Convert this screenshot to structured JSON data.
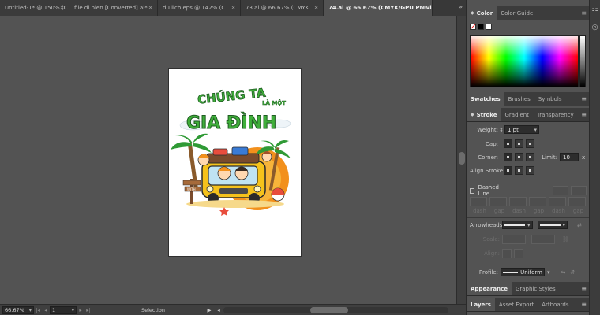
{
  "doc_tabs": [
    {
      "label": "Untitled-1* @ 150% (C...",
      "active": false
    },
    {
      "label": "file di bien [Converted].ai*",
      "active": false
    },
    {
      "label": "du lich.eps @ 142% (C...",
      "active": false
    },
    {
      "label": "73.ai @ 66.67% (CMYK...",
      "active": false
    },
    {
      "label": "74.ai @ 66.67% (CMYK/GPU Preview)",
      "active": true
    }
  ],
  "artwork": {
    "line1": "CHÚNG TA",
    "line2": "LÀ MỘT",
    "line3": "GIA ĐÌNH",
    "sign": "WITH"
  },
  "status_bar": {
    "zoom": "66.67%",
    "page": "1",
    "tool": "Selection"
  },
  "color_panel": {
    "tabs": [
      "Color",
      "Color Guide"
    ]
  },
  "swatches_panel": {
    "tabs": [
      "Swatches",
      "Brushes",
      "Symbols"
    ]
  },
  "stroke_panel": {
    "tabs": [
      "Stroke",
      "Gradient",
      "Transparency"
    ],
    "weight_label": "Weight:",
    "weight_value": "1 pt",
    "cap_label": "Cap:",
    "corner_label": "Corner:",
    "limit_label": "Limit:",
    "limit_value": "10",
    "limit_unit": "x",
    "align_label": "Align Stroke:",
    "dashed_label": "Dashed Line",
    "dash_labels": [
      "dash",
      "gap",
      "dash",
      "gap",
      "dash",
      "gap"
    ],
    "arrowheads_label": "Arrowheads:",
    "scale_label": "Scale:",
    "align2_label": "Align:",
    "profile_label": "Profile:",
    "profile_value": "Uniform"
  },
  "appearance_panel": {
    "tabs": [
      "Appearance",
      "Graphic Styles"
    ]
  },
  "layers_panel": {
    "tabs": [
      "Layers",
      "Asset Export",
      "Artboards"
    ]
  },
  "colors": {
    "accent_green": "#3fae3a",
    "bus_yellow": "#f5c21b",
    "sun_orange": "#f2901c"
  }
}
